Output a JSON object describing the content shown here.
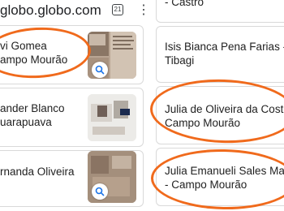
{
  "browser": {
    "url_fragment": "globo.globo.com",
    "tab_count": "21"
  },
  "left_column": [
    {
      "name_line1": "vi Gomea",
      "name_line2": "ampo Mourão"
    },
    {
      "name_line1": "ander Blanco",
      "name_line2": "uarapuava"
    },
    {
      "name_line1": "rnanda Oliveira",
      "name_line2": ""
    }
  ],
  "right_column": [
    {
      "line1": "- Castro",
      "line2": ""
    },
    {
      "line1": "Isis Bianca Pena Farias -",
      "line2": "Tibagi"
    },
    {
      "line1": "Julia de Oliveira da Costa",
      "line2": "Campo Mourão"
    },
    {
      "line1": "Julia Emanueli Sales Mai",
      "line2": "- Campo Mourão"
    }
  ],
  "accent_colors": {
    "highlight_circle": "#f06a1c"
  },
  "icons": {
    "zoom": "search-icon",
    "menu": "more-vert-icon",
    "tabs": "tabs-counter-icon"
  }
}
